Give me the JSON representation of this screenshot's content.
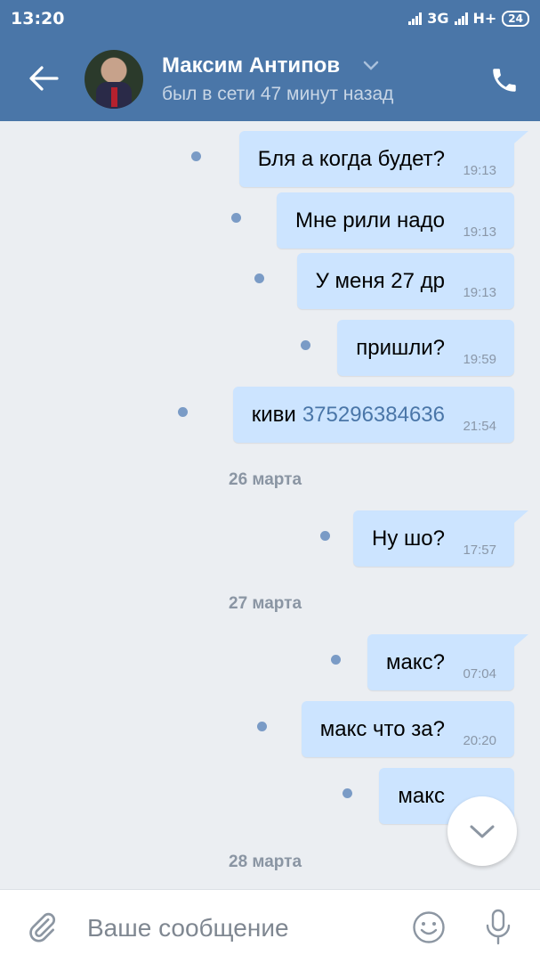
{
  "status_bar": {
    "time": "13:20",
    "network": "3G",
    "network2": "H+",
    "battery": "24"
  },
  "header": {
    "contact_name": "Максим Антипов",
    "last_seen": "был в сети 47 минут назад",
    "icons": [
      "back-arrow-icon",
      "chevron-down-icon",
      "phone-icon"
    ]
  },
  "messages": [
    {
      "text": "Бля а когда будет?",
      "time": "19:13"
    },
    {
      "text": "Мне рили надо",
      "time": "19:13"
    },
    {
      "text": "У меня 27 др",
      "time": "19:13"
    },
    {
      "text": "пришли?",
      "time": "19:59"
    },
    {
      "text": "киви",
      "link": "375296384636",
      "time": "21:54"
    },
    {
      "date": "26 марта"
    },
    {
      "text": "Ну шо?",
      "time": "17:57"
    },
    {
      "date": "27 марта"
    },
    {
      "text": "макс?",
      "time": "07:04"
    },
    {
      "text": "макс что за?",
      "time": "20:20"
    },
    {
      "text": "макс",
      "time": ""
    },
    {
      "date": "28 марта"
    }
  ],
  "composer": {
    "placeholder": "Ваше сообщение",
    "icons": [
      "paperclip-icon",
      "emoji-icon",
      "microphone-icon"
    ]
  },
  "colors": {
    "accent": "#4a76a8",
    "bubble": "#cce4ff",
    "background": "#ebeef2",
    "unread_dot": "#7a9bc6"
  }
}
